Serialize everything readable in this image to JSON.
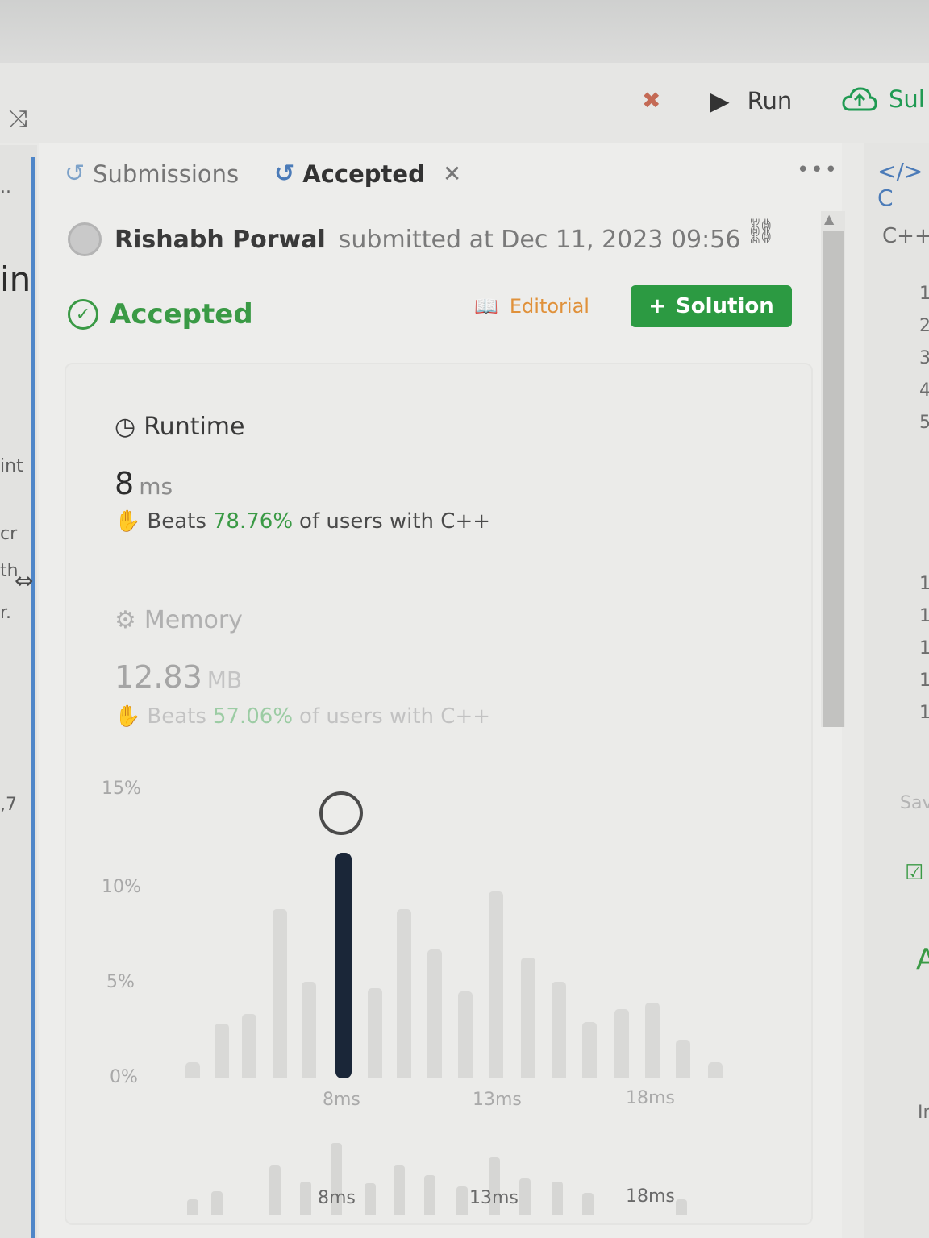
{
  "toolbar": {
    "shuffle_icon": "shuffle-icon",
    "debug_icon": "bug-icon",
    "run_label": "Run",
    "submit_label": "Sul"
  },
  "tabs": [
    {
      "label": "Submissions",
      "icon": "history-icon"
    },
    {
      "label": "Accepted",
      "icon": "history-icon",
      "active": true
    }
  ],
  "submission": {
    "user": "Rishabh Porwal",
    "submitted_text": "submitted at Dec 11, 2023 09:56"
  },
  "status": {
    "label": "Accepted",
    "color": "#3a9a45"
  },
  "actions": {
    "editorial_label": "Editorial",
    "solution_label": "Solution",
    "solution_color": "#2c9a42"
  },
  "runtime": {
    "label": "Runtime",
    "value": "8",
    "unit": "ms",
    "beats_prefix": "Beats",
    "beats_pct": "78.76%",
    "beats_suffix": "of users with C++"
  },
  "memory": {
    "label": "Memory",
    "value": "12.83",
    "unit": "MB",
    "beats_prefix": "Beats",
    "beats_pct": "57.06%",
    "beats_suffix": "of users with C++"
  },
  "chart": {
    "y_ticks": [
      "15%",
      "10%",
      "5%",
      "0%"
    ],
    "x_ticks": [
      "8ms",
      "13ms",
      "18ms"
    ],
    "mini_x_ticks": [
      "8ms",
      "13ms",
      "18ms"
    ],
    "selected": "8ms",
    "accent": "#1a2638"
  },
  "side": {
    "left_fragments": [
      "..",
      "in",
      "int",
      "cr",
      "th",
      "r.",
      ",7"
    ],
    "right_fragments": [
      "</> C",
      "C++",
      "1",
      "2",
      "3",
      "4",
      "5",
      "1",
      "1",
      "1",
      "1",
      "1",
      "Sav",
      "A",
      "Ir"
    ]
  }
}
